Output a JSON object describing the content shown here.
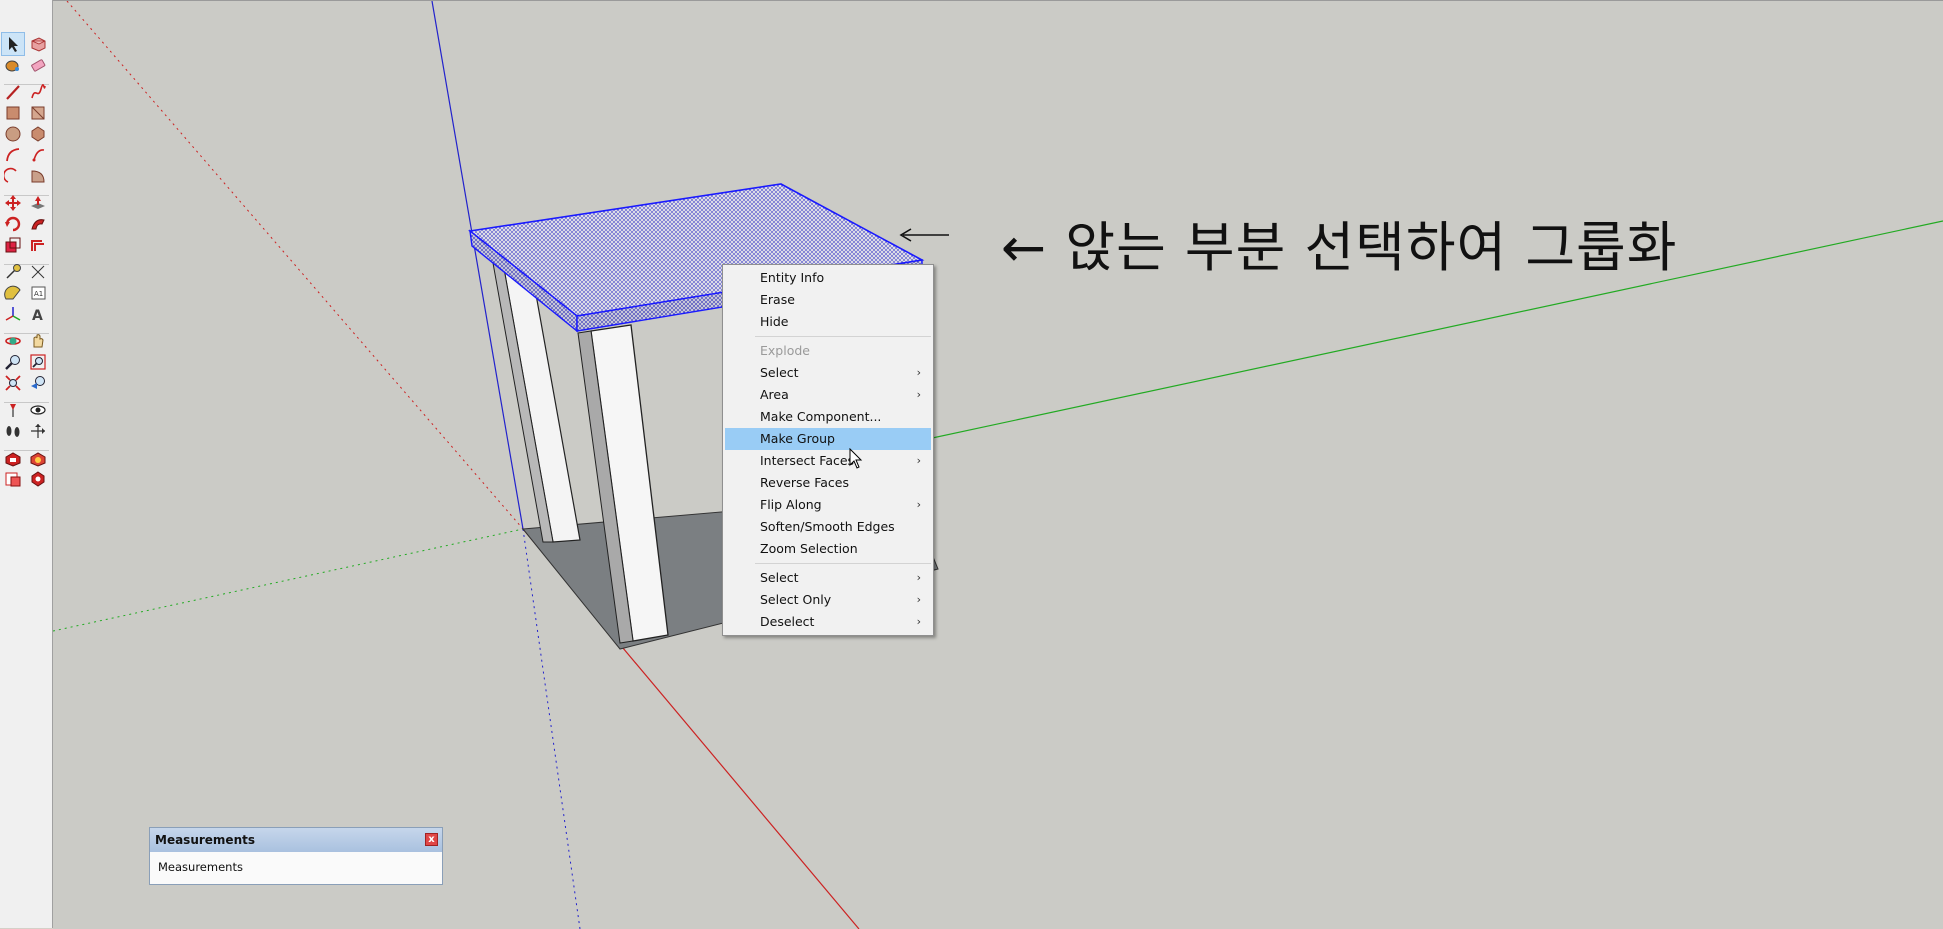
{
  "toolbar": {
    "tools": [
      "select-tool-icon",
      "make-component-icon",
      "paint-bucket-icon",
      "eraser-icon",
      "line-tool-icon",
      "freehand-tool-icon",
      "rectangle-tool-icon",
      "rotated-rectangle-icon",
      "circle-tool-icon",
      "polygon-tool-icon",
      "arc-tool-icon",
      "pie-tool-icon",
      "two-point-arc-icon",
      "three-point-arc-icon",
      "move-tool-icon",
      "push-pull-icon",
      "rotate-tool-icon",
      "follow-me-icon",
      "scale-tool-icon",
      "offset-tool-icon",
      "tape-measure-icon",
      "dimension-tool-icon",
      "protractor-icon",
      "text-tool-icon",
      "axes-tool-icon",
      "3d-text-icon",
      "orbit-tool-icon",
      "pan-tool-icon",
      "zoom-tool-icon",
      "zoom-window-icon",
      "zoom-extents-icon",
      "previous-view-icon",
      "position-camera-icon",
      "look-around-icon",
      "walk-tool-icon",
      "section-plane-icon",
      "warehouse-icon",
      "extension-warehouse-icon",
      "layout-send-icon",
      "extension-manager-icon"
    ]
  },
  "annotation": {
    "text": "←  앉는 부분 선택하여 그룹화"
  },
  "context_menu": {
    "items": [
      {
        "label": "Entity Info",
        "has_submenu": false,
        "disabled": false,
        "highlighted": false
      },
      {
        "label": "Erase",
        "has_submenu": false,
        "disabled": false,
        "highlighted": false
      },
      {
        "label": "Hide",
        "has_submenu": false,
        "disabled": false,
        "highlighted": false
      },
      {
        "separator": true
      },
      {
        "label": "Explode",
        "has_submenu": false,
        "disabled": true,
        "highlighted": false
      },
      {
        "label": "Select",
        "has_submenu": true,
        "disabled": false,
        "highlighted": false
      },
      {
        "label": "Area",
        "has_submenu": true,
        "disabled": false,
        "highlighted": false
      },
      {
        "label": "Make Component...",
        "has_submenu": false,
        "disabled": false,
        "highlighted": false
      },
      {
        "label": "Make Group",
        "has_submenu": false,
        "disabled": false,
        "highlighted": true
      },
      {
        "label": "Intersect Faces",
        "has_submenu": true,
        "disabled": false,
        "highlighted": false
      },
      {
        "label": "Reverse Faces",
        "has_submenu": false,
        "disabled": false,
        "highlighted": false
      },
      {
        "label": "Flip Along",
        "has_submenu": true,
        "disabled": false,
        "highlighted": false
      },
      {
        "label": "Soften/Smooth Edges",
        "has_submenu": false,
        "disabled": false,
        "highlighted": false
      },
      {
        "label": "Zoom Selection",
        "has_submenu": false,
        "disabled": false,
        "highlighted": false
      },
      {
        "separator": true
      },
      {
        "label": "Select",
        "has_submenu": true,
        "disabled": false,
        "highlighted": false
      },
      {
        "label": "Select Only",
        "has_submenu": true,
        "disabled": false,
        "highlighted": false
      },
      {
        "label": "Deselect",
        "has_submenu": true,
        "disabled": false,
        "highlighted": false
      }
    ]
  },
  "measurements": {
    "title": "Measurements",
    "label": "Measurements",
    "close_icon": "close-icon"
  },
  "colors": {
    "viewport_bg": "#cbcbc6",
    "axis_red": "#cc2222",
    "axis_green": "#22aa22",
    "axis_blue": "#2222cc",
    "selection": "#1a1aff",
    "menu_highlight": "#99ccf5"
  }
}
